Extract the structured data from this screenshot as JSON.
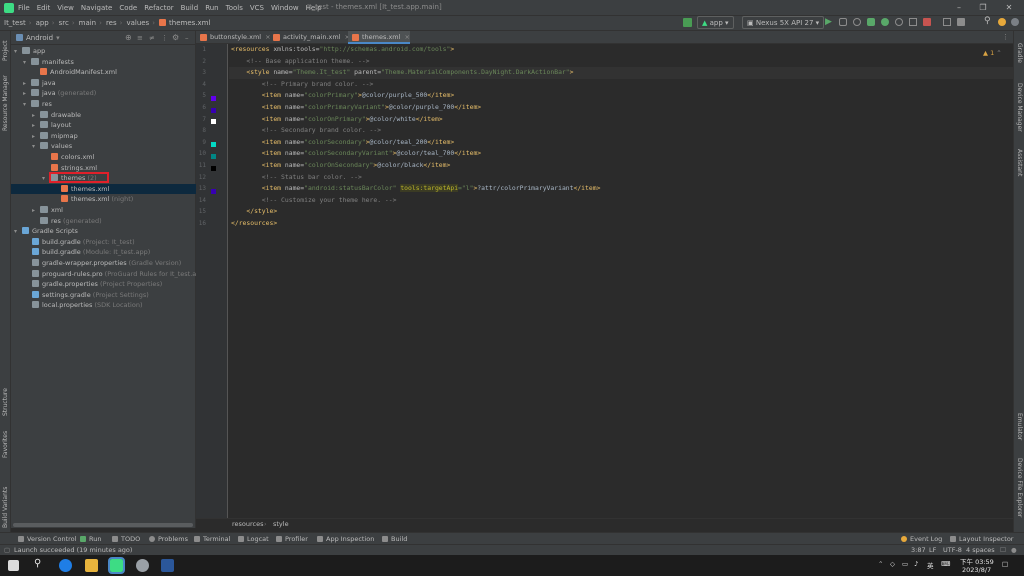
{
  "menu": [
    "File",
    "Edit",
    "View",
    "Navigate",
    "Code",
    "Refactor",
    "Build",
    "Run",
    "Tools",
    "VCS",
    "Window",
    "Help"
  ],
  "window_title": "It_test - themes.xml [It_test.app.main]",
  "breadcrumb": [
    "It_test",
    "app",
    "src",
    "main",
    "res",
    "values",
    "themes.xml"
  ],
  "toolbar": {
    "run_config": "app",
    "device": "Nexus 5X API 27"
  },
  "project_panel": {
    "view": "Android",
    "tree": [
      {
        "label": "app",
        "extra": ""
      },
      {
        "label": "manifests",
        "extra": ""
      },
      {
        "label": "AndroidManifest.xml",
        "extra": ""
      },
      {
        "label": "java",
        "extra": ""
      },
      {
        "label": "java",
        "extra": "(generated)"
      },
      {
        "label": "res",
        "extra": ""
      },
      {
        "label": "drawable",
        "extra": ""
      },
      {
        "label": "layout",
        "extra": ""
      },
      {
        "label": "mipmap",
        "extra": ""
      },
      {
        "label": "values",
        "extra": ""
      },
      {
        "label": "colors.xml",
        "extra": ""
      },
      {
        "label": "strings.xml",
        "extra": ""
      },
      {
        "label": "themes",
        "extra": "(2)"
      },
      {
        "label": "themes.xml",
        "extra": ""
      },
      {
        "label": "themes.xml",
        "extra": "(night)"
      },
      {
        "label": "xml",
        "extra": ""
      },
      {
        "label": "res",
        "extra": "(generated)"
      },
      {
        "label": "Gradle Scripts",
        "extra": ""
      },
      {
        "label": "build.gradle",
        "extra": "(Project: It_test)"
      },
      {
        "label": "build.gradle",
        "extra": "(Module: It_test.app)"
      },
      {
        "label": "gradle-wrapper.properties",
        "extra": "(Gradle Version)"
      },
      {
        "label": "proguard-rules.pro",
        "extra": "(ProGuard Rules for It_test.app)"
      },
      {
        "label": "gradle.properties",
        "extra": "(Project Properties)"
      },
      {
        "label": "settings.gradle",
        "extra": "(Project Settings)"
      },
      {
        "label": "local.properties",
        "extra": "(SDK Location)"
      }
    ]
  },
  "editor_tabs": [
    "buttonstyle.xml",
    "activity_main.xml",
    "themes.xml"
  ],
  "line_numbers": [
    "1",
    "2",
    "3",
    "4",
    "5",
    "6",
    "7",
    "8",
    "9",
    "10",
    "11",
    "12",
    "13",
    "14",
    "15",
    "16"
  ],
  "code": {
    "l1_tag": "<resources",
    "l1_attr": " xmlns:tools=",
    "l1_val": "\"http://schemas.android.com/tools\"",
    "l1_end": ">",
    "l2": "    <!-- Base application theme. -->",
    "l3_tag": "    <style",
    "l3_a1": " name=",
    "l3_v1": "\"Theme.It_test\"",
    "l3_a2": " parent=",
    "l3_v2": "\"Theme.MaterialComponents.DayNight.DarkActionBar\"",
    "l3_end": ">",
    "l4": "        <!-- Primary brand color. -->",
    "items": [
      {
        "name": "\"colorPrimary\"",
        "value": "@color/purple_500"
      },
      {
        "name": "\"colorPrimaryVariant\"",
        "value": "@color/purple_700"
      },
      {
        "name": "\"colorOnPrimary\"",
        "value": "@color/white"
      }
    ],
    "l8": "        <!-- Secondary brand color. -->",
    "items2": [
      {
        "name": "\"colorSecondary\"",
        "value": "@color/teal_200"
      },
      {
        "name": "\"colorSecondaryVariant\"",
        "value": "@color/teal_700"
      },
      {
        "name": "\"colorOnSecondary\"",
        "value": "@color/black"
      }
    ],
    "l12": "        <!-- Status bar color. -->",
    "l13_name": "\"android:statusBarColor\"",
    "l13_tools": "tools:targetApi",
    "l13_tv": "=\"l\"",
    "l13_value": "?attr/colorPrimaryVariant",
    "l14": "        <!-- Customize your theme here. -->",
    "l15": "    </style>",
    "l16": "</resources>",
    "item_open": "        <item",
    "name_attr": " name=",
    "item_close": "</item>",
    "gt": ">"
  },
  "warning_count": "1",
  "editor_breadcrumb": [
    "resources",
    "style"
  ],
  "left_stripe": [
    "Project",
    "Resource Manager",
    "Structure",
    "Favorites",
    "Build Variants"
  ],
  "right_stripe": [
    "Gradle",
    "Device Manager",
    "Assistant",
    "Emulator",
    "Device File Explorer"
  ],
  "bottom_tools": [
    "Version Control",
    "Run",
    "TODO",
    "Problems",
    "Terminal",
    "Logcat",
    "Profiler",
    "App Inspection",
    "Build"
  ],
  "bottom_right_tools": [
    "Event Log",
    "Layout Inspector"
  ],
  "status": {
    "message": "Launch succeeded (19 minutes ago)",
    "position": "3:87",
    "line_sep": "LF",
    "encoding": "UTF-8",
    "indent": "4 spaces"
  },
  "taskbar": {
    "ime": "英",
    "time": "下午 03:59",
    "date": "2023/8/7"
  },
  "colors": {
    "purple_500": "#6200ee",
    "purple_700": "#3700b3",
    "white": "#ffffff",
    "teal_200": "#03dac5",
    "teal_700": "#018786",
    "black": "#000000",
    "highlight_box": "#e0202a"
  }
}
